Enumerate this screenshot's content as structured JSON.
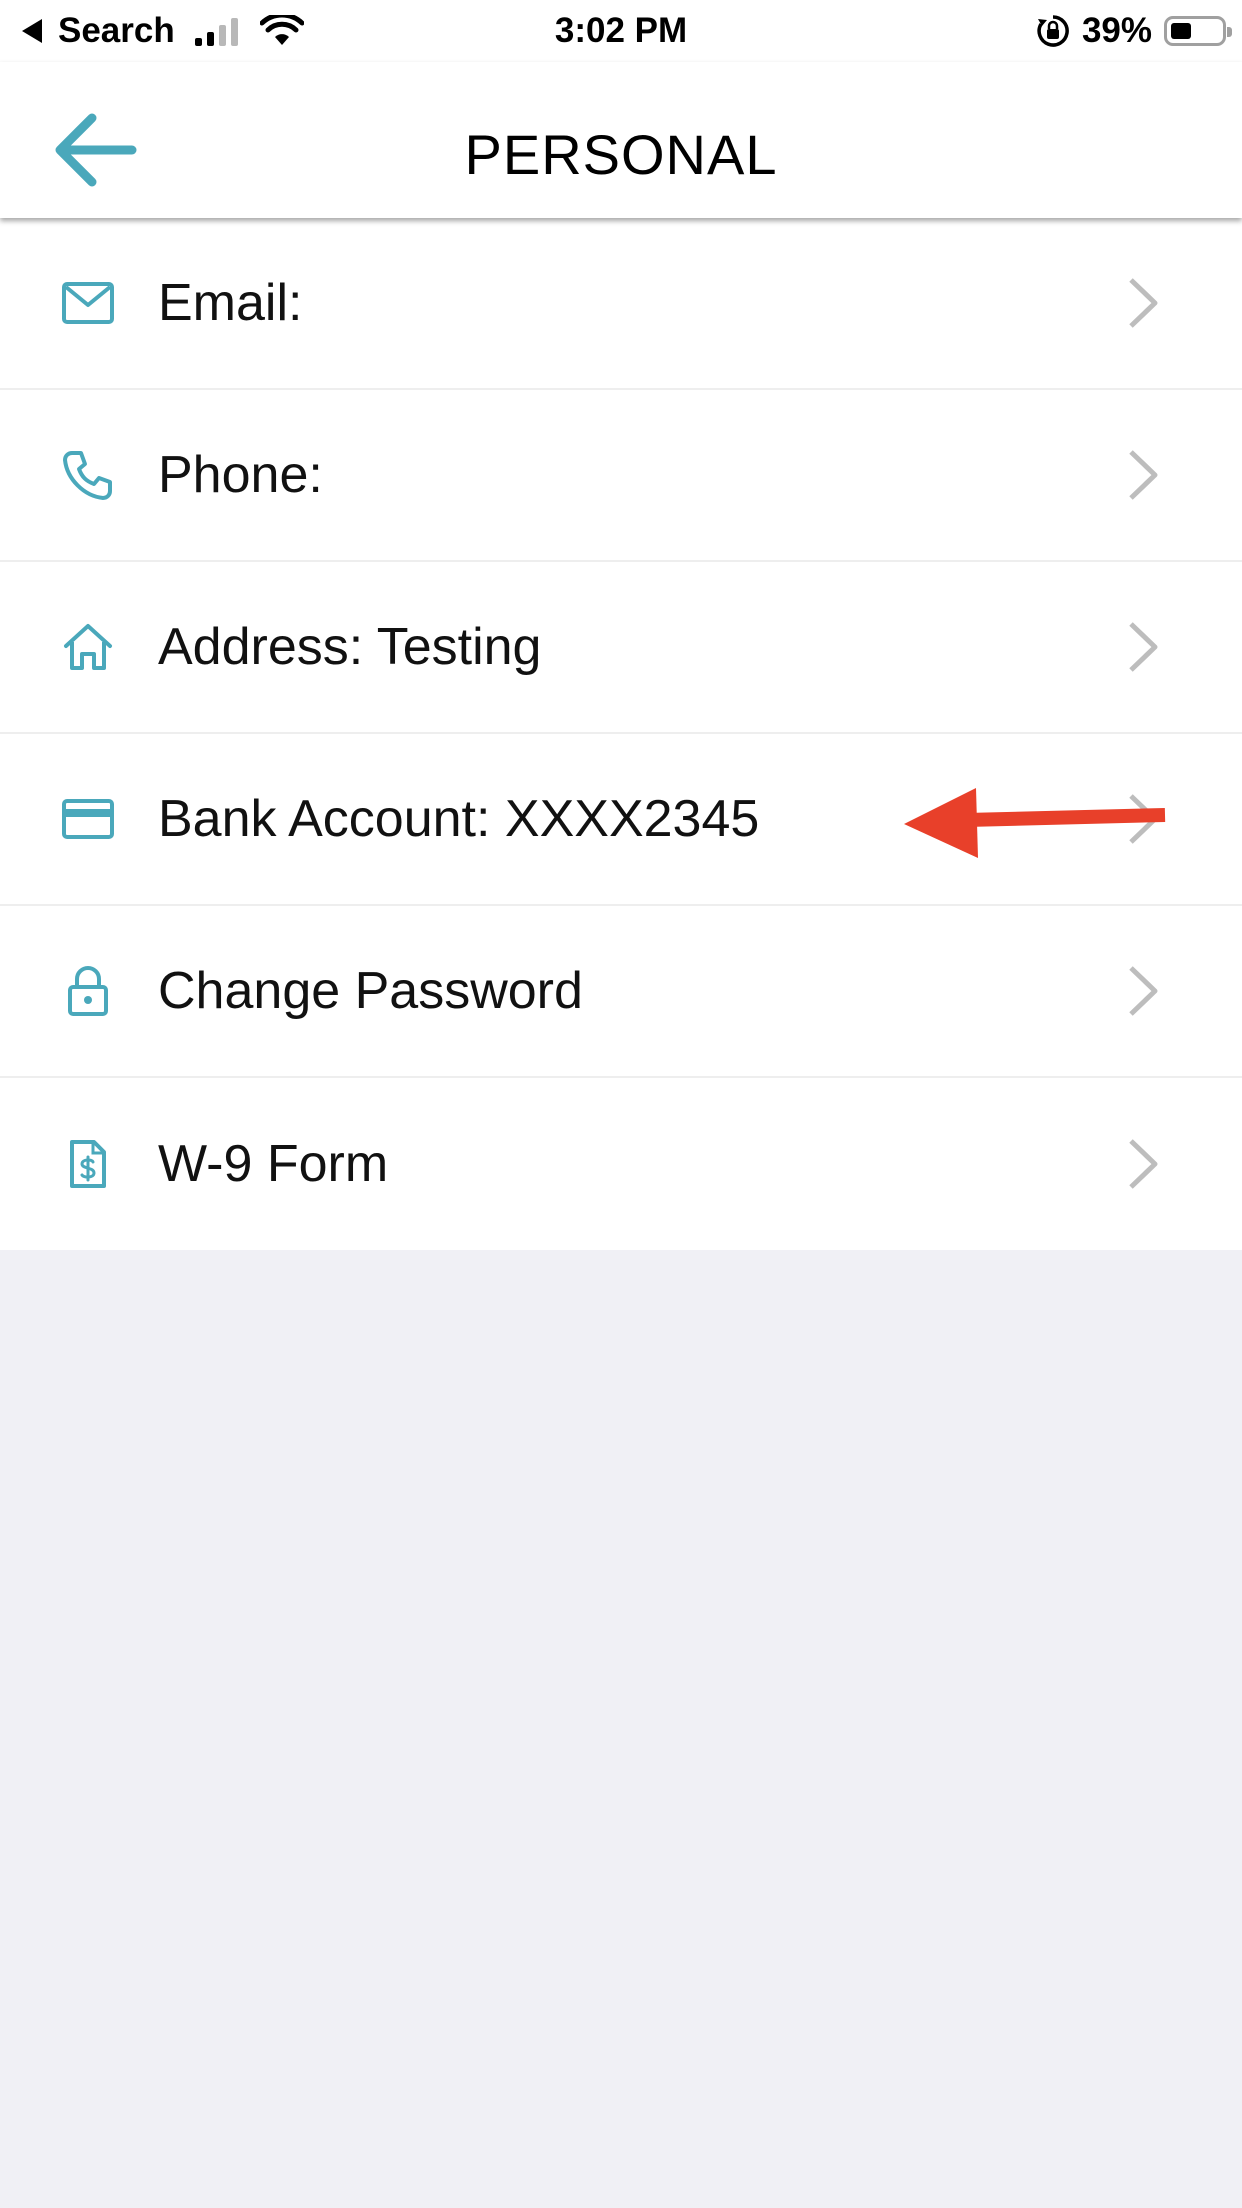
{
  "status_bar": {
    "back_label": "Search",
    "time": "3:02 PM",
    "battery_percent": "39%",
    "battery_level": 0.39
  },
  "nav": {
    "title": "PERSONAL",
    "back_icon": "arrow-left-icon"
  },
  "rows": [
    {
      "icon": "envelope-icon",
      "label": "Email:"
    },
    {
      "icon": "phone-icon",
      "label": "Phone:"
    },
    {
      "icon": "home-icon",
      "label": "Address: Testing"
    },
    {
      "icon": "credit-card-icon",
      "label": "Bank Account: XXXX2345"
    },
    {
      "icon": "lock-icon",
      "label": "Change Password"
    },
    {
      "icon": "document-dollar-icon",
      "label": "W-9 Form"
    }
  ],
  "colors": {
    "accent": "#4aa8bb",
    "chevron": "#bdbdbd",
    "annotation_arrow": "#e8402a",
    "background": "#f0f0f5"
  }
}
